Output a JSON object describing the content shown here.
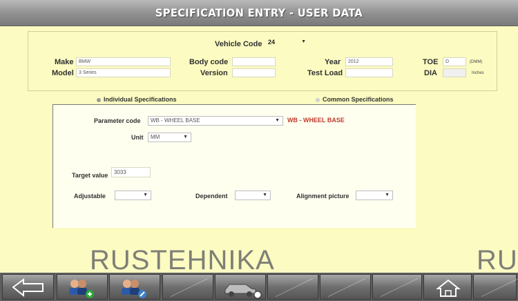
{
  "title": "SPECIFICATION ENTRY - USER DATA",
  "vehicle": {
    "code_label": "Vehicle Code",
    "code_value": "24",
    "make_label": "Make",
    "make_value": "BMW",
    "model_label": "Model",
    "model_value": "3 Series",
    "body_label": "Body code",
    "body_value": "",
    "version_label": "Version",
    "version_value": "",
    "year_label": "Year",
    "year_value": "2012",
    "testload_label": "Test Load",
    "testload_value": "",
    "toe_label": "TOE",
    "toe_value": "D",
    "toe_unit": "(DMM)",
    "dia_label": "DIA",
    "dia_value": "",
    "dia_unit": "Inches"
  },
  "spec_modes": {
    "individual": "Individual Specifications",
    "common": "Common Specifications",
    "selected": "individual"
  },
  "spec": {
    "param_label": "Parameter code",
    "param_value": "WB - WHEEL BASE",
    "param_title": "WB - WHEEL BASE",
    "unit_label": "Unit",
    "unit_value": "MM",
    "target_label": "Target value",
    "target_value": "3033",
    "adjustable_label": "Adjustable",
    "adjustable_value": "",
    "dependent_label": "Dependent",
    "dependent_value": "",
    "picture_label": "Alignment picture",
    "picture_value": ""
  },
  "watermark": {
    "text": "RUSTEHNIKA",
    "text_right": "RU"
  },
  "toolbar": {
    "buttons": [
      "back-icon",
      "add-users-icon",
      "edit-users-icon",
      "blank",
      "car-lift-icon",
      "blank",
      "blank",
      "blank",
      "home-icon",
      "blank"
    ]
  },
  "colors": {
    "background": "#fbfbc2",
    "title_bar": "#8f8f8f",
    "param_title": "#c0392b",
    "toolbar": "#5e5e5e"
  }
}
